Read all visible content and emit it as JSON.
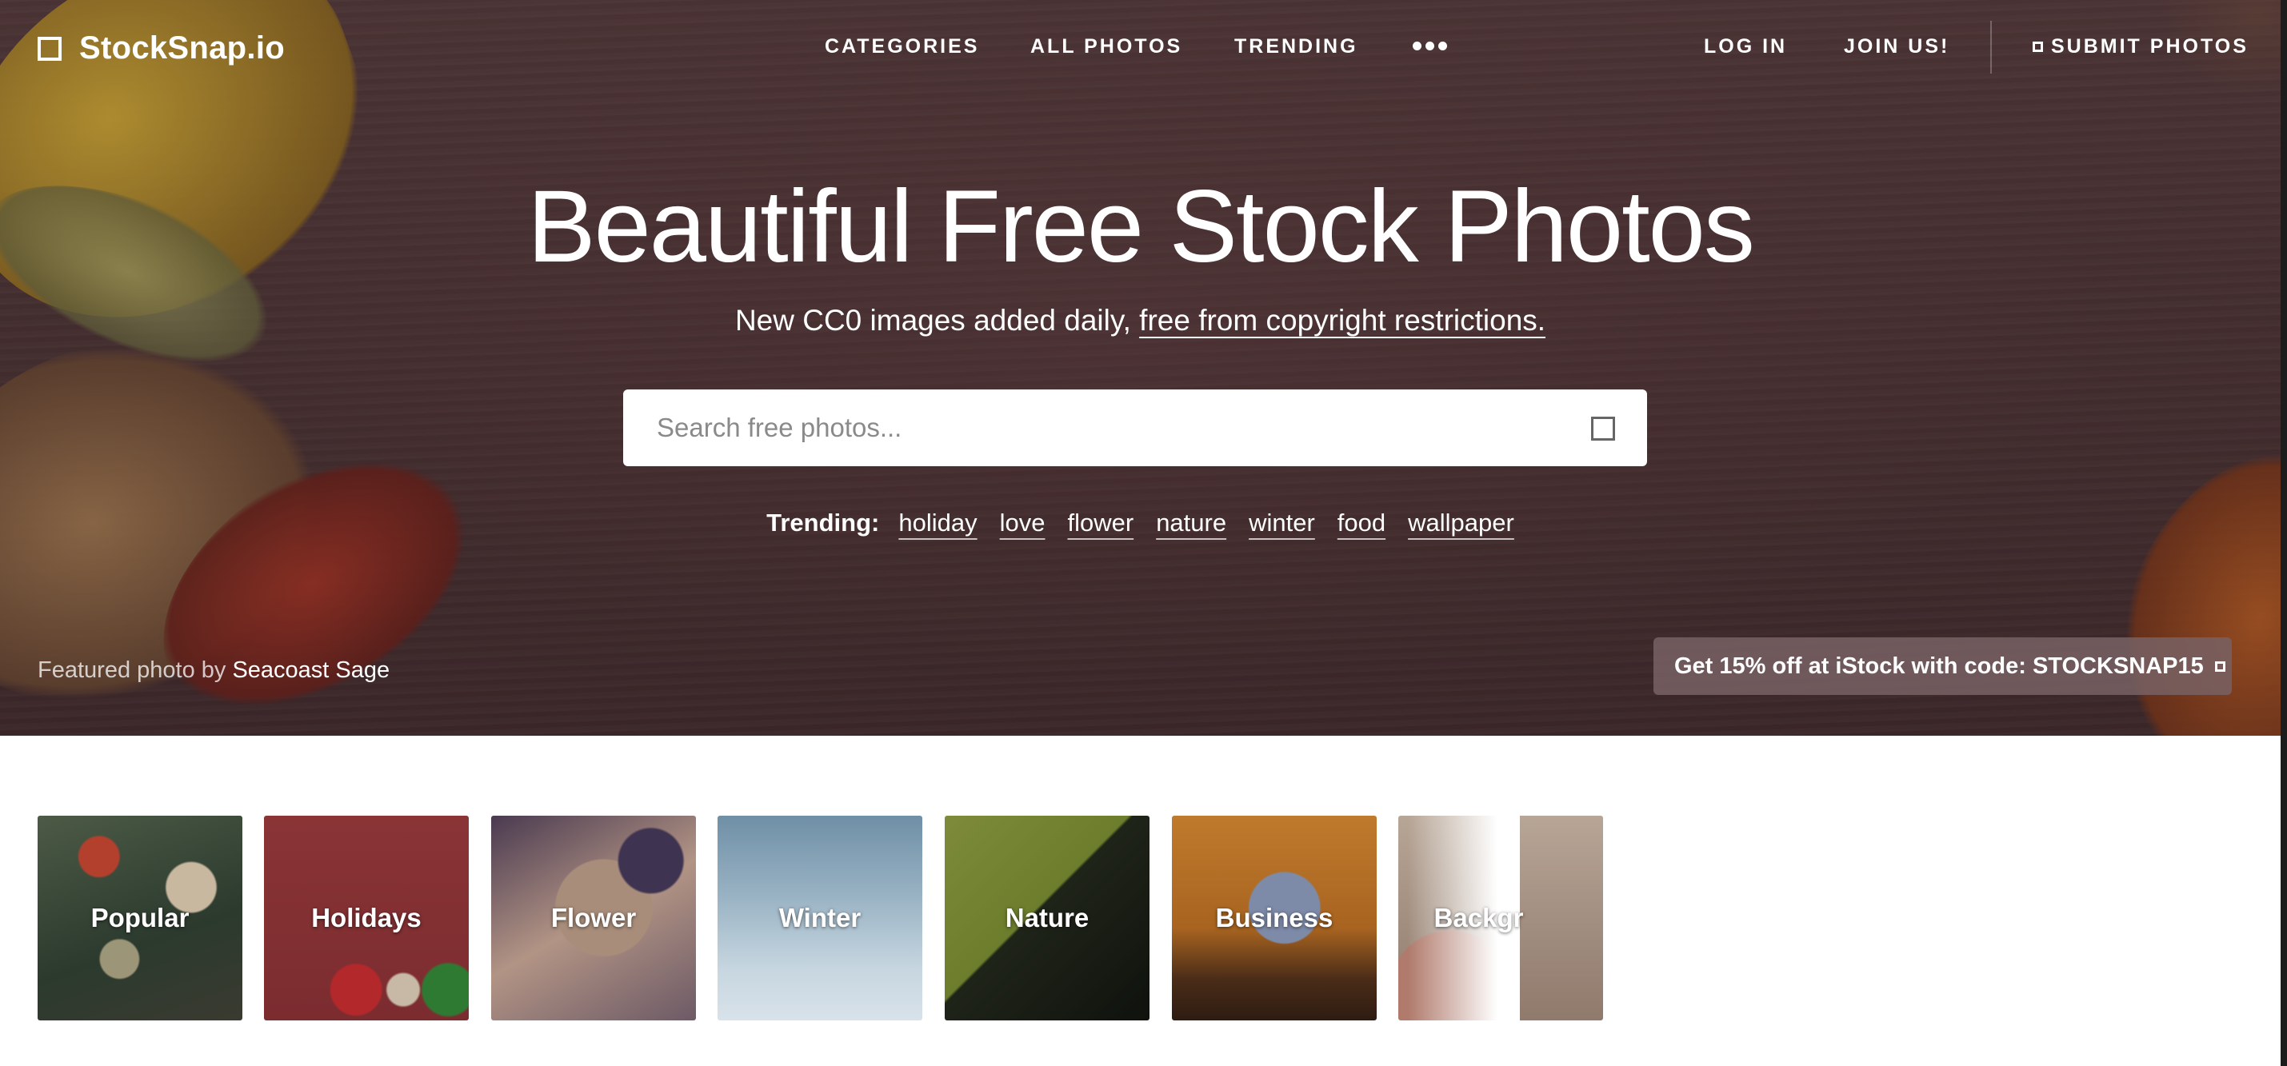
{
  "brand": {
    "name": "StockSnap.io"
  },
  "nav": {
    "left": [
      "CATEGORIES",
      "ALL PHOTOS",
      "TRENDING"
    ],
    "more_icon": "ellipsis-icon",
    "login": "LOG IN",
    "join": "JOIN US!",
    "submit": "SUBMIT PHOTOS"
  },
  "hero": {
    "headline": "Beautiful Free Stock Photos",
    "subline_prefix": "New CC0 images added daily,",
    "subline_link": "free from copyright restrictions.",
    "search_placeholder": "Search free photos...",
    "search_value": "",
    "trending_label": "Trending:",
    "trending_tags": [
      "holiday",
      "love",
      "flower",
      "nature",
      "winter",
      "food",
      "wallpaper"
    ],
    "featured_prefix": "Featured photo by",
    "featured_author": "Seacoast Sage",
    "promo": "Get 15% off at iStock with code: STOCKSNAP15"
  },
  "categories": [
    "Popular",
    "Holidays",
    "Flower",
    "Winter",
    "Nature",
    "Business",
    "Backgr"
  ],
  "colors": {
    "hero_bg": "#432e30",
    "promo_bg": "#786264",
    "text": "#ffffff"
  }
}
